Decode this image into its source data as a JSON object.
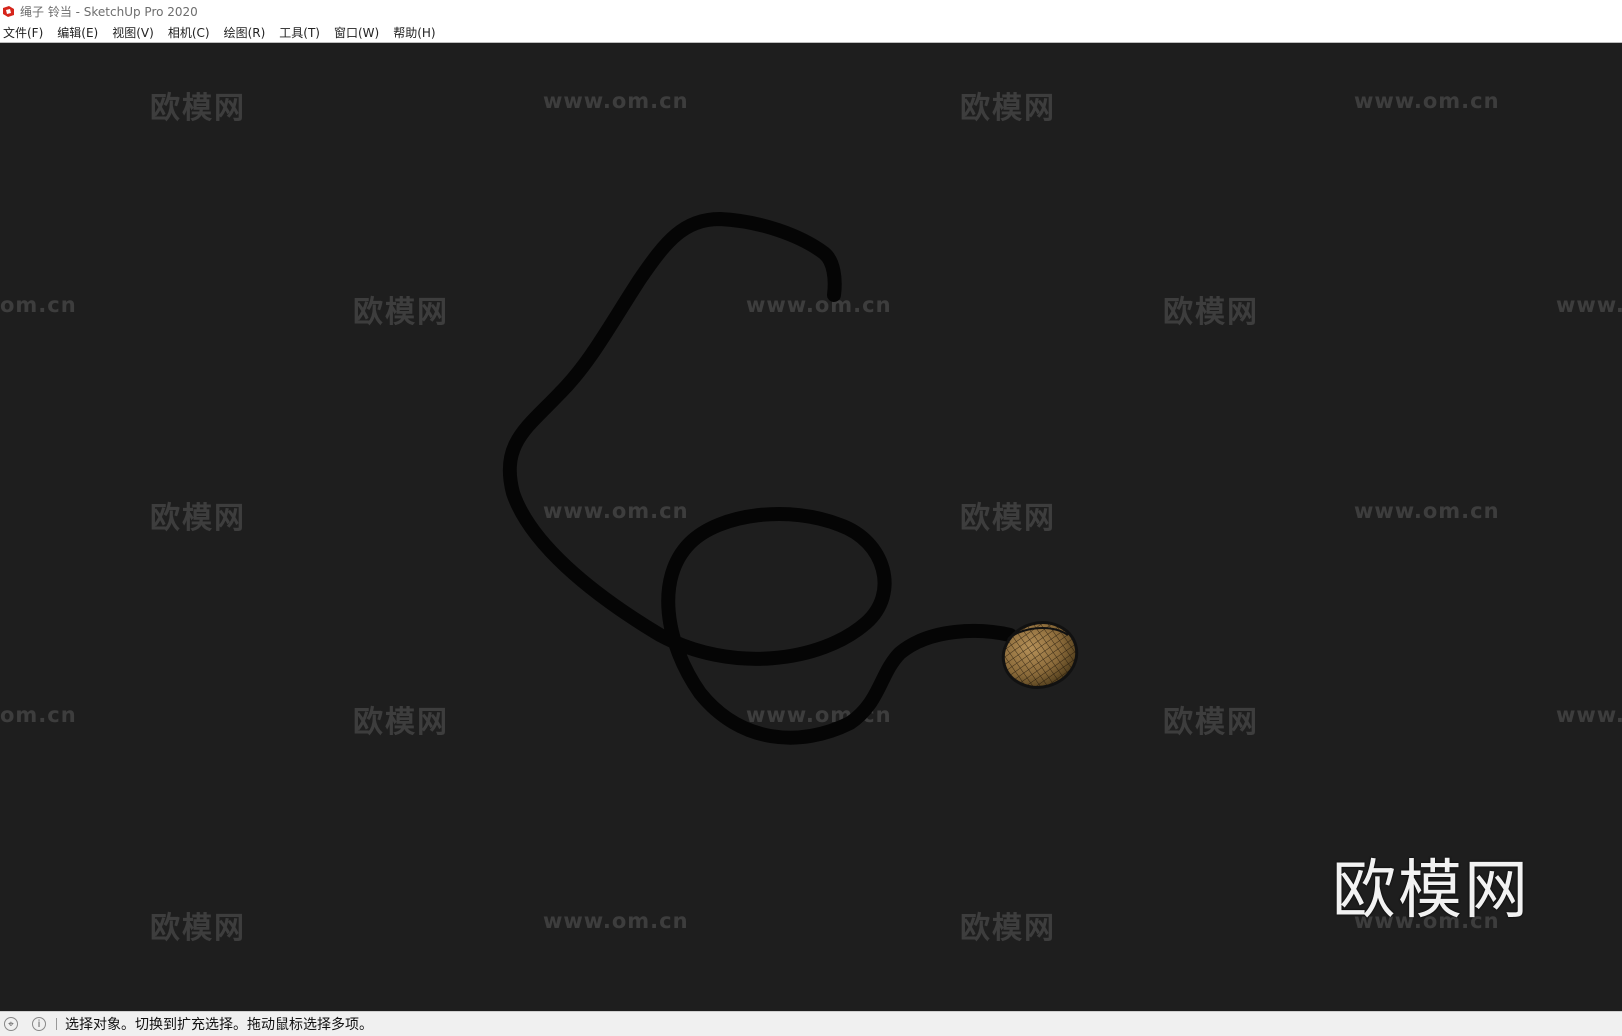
{
  "window": {
    "title": "绳子 铃当 - SketchUp Pro 2020",
    "app_icon": "sketchup-logo-icon"
  },
  "menubar": {
    "items": [
      {
        "label": "文件(F)"
      },
      {
        "label": "编辑(E)"
      },
      {
        "label": "视图(V)"
      },
      {
        "label": "相机(C)"
      },
      {
        "label": "绘图(R)"
      },
      {
        "label": "工具(T)"
      },
      {
        "label": "窗口(W)"
      },
      {
        "label": "帮助(H)"
      }
    ]
  },
  "viewport": {
    "background": "#1e1e1e",
    "model": {
      "rope_color": "#050505",
      "bell_color": "#8a6a3a"
    },
    "watermarks": {
      "cn_text": "欧模网",
      "url_text": "www.om.cn",
      "partial_url_left": "om.cn",
      "partial_url_right": "www.",
      "big_logo": "欧模网"
    }
  },
  "statusbar": {
    "icons": [
      "geo-location-icon",
      "info-icon"
    ],
    "message": "选择对象。切换到扩充选择。拖动鼠标选择多项。"
  }
}
